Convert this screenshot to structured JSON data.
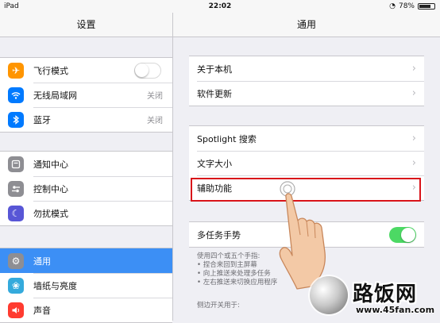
{
  "status_bar": {
    "carrier": "iPad",
    "time": "22:02",
    "battery": "78%",
    "battery_level": 0.78
  },
  "sidebar": {
    "title": "设置",
    "groups": [
      {
        "items": [
          {
            "label": "飞行模式",
            "icon": "airplane-icon",
            "color": "#ff9500",
            "control": "toggle",
            "toggle_on": false
          },
          {
            "label": "无线局域网",
            "icon": "wifi-icon",
            "color": "#007aff",
            "value": "关闭"
          },
          {
            "label": "蓝牙",
            "icon": "bluetooth-icon",
            "color": "#007aff",
            "value": "关闭"
          }
        ]
      },
      {
        "items": [
          {
            "label": "通知中心",
            "icon": "notification-center-icon",
            "color": "#8e8e93"
          },
          {
            "label": "控制中心",
            "icon": "control-center-icon",
            "color": "#8e8e93"
          },
          {
            "label": "勿扰模式",
            "icon": "moon-icon",
            "color": "#5856d6"
          }
        ]
      },
      {
        "items": [
          {
            "label": "通用",
            "icon": "gear-icon",
            "color": "#8e8e93",
            "selected": true
          },
          {
            "label": "墙纸与亮度",
            "icon": "wallpaper-icon",
            "color": "#34aadc"
          },
          {
            "label": "声音",
            "icon": "speaker-icon",
            "color": "#ff3b30"
          }
        ]
      }
    ]
  },
  "detail": {
    "title": "通用",
    "groups": [
      {
        "items": [
          {
            "label": "关于本机"
          },
          {
            "label": "软件更新"
          }
        ]
      },
      {
        "items": [
          {
            "label": "Spotlight 搜索"
          },
          {
            "label": "文字大小"
          },
          {
            "label": "辅助功能",
            "highlighted": true
          }
        ]
      },
      {
        "items": [
          {
            "label": "多任务手势",
            "control": "toggle",
            "toggle_on": true
          }
        ]
      }
    ],
    "footnote_lines": [
      "使用四个或五个手指:",
      "• 捏合来回到主屏幕",
      "• 向上推送来处理多任务",
      "• 左右推送来切换应用程序"
    ],
    "next_section_header": "侧边开关用于:",
    "highlight_color": "#d9141a",
    "accent_color": "#3c8ff5"
  },
  "watermark": {
    "brand": "路饭网",
    "domain": "www.45fan.com"
  }
}
